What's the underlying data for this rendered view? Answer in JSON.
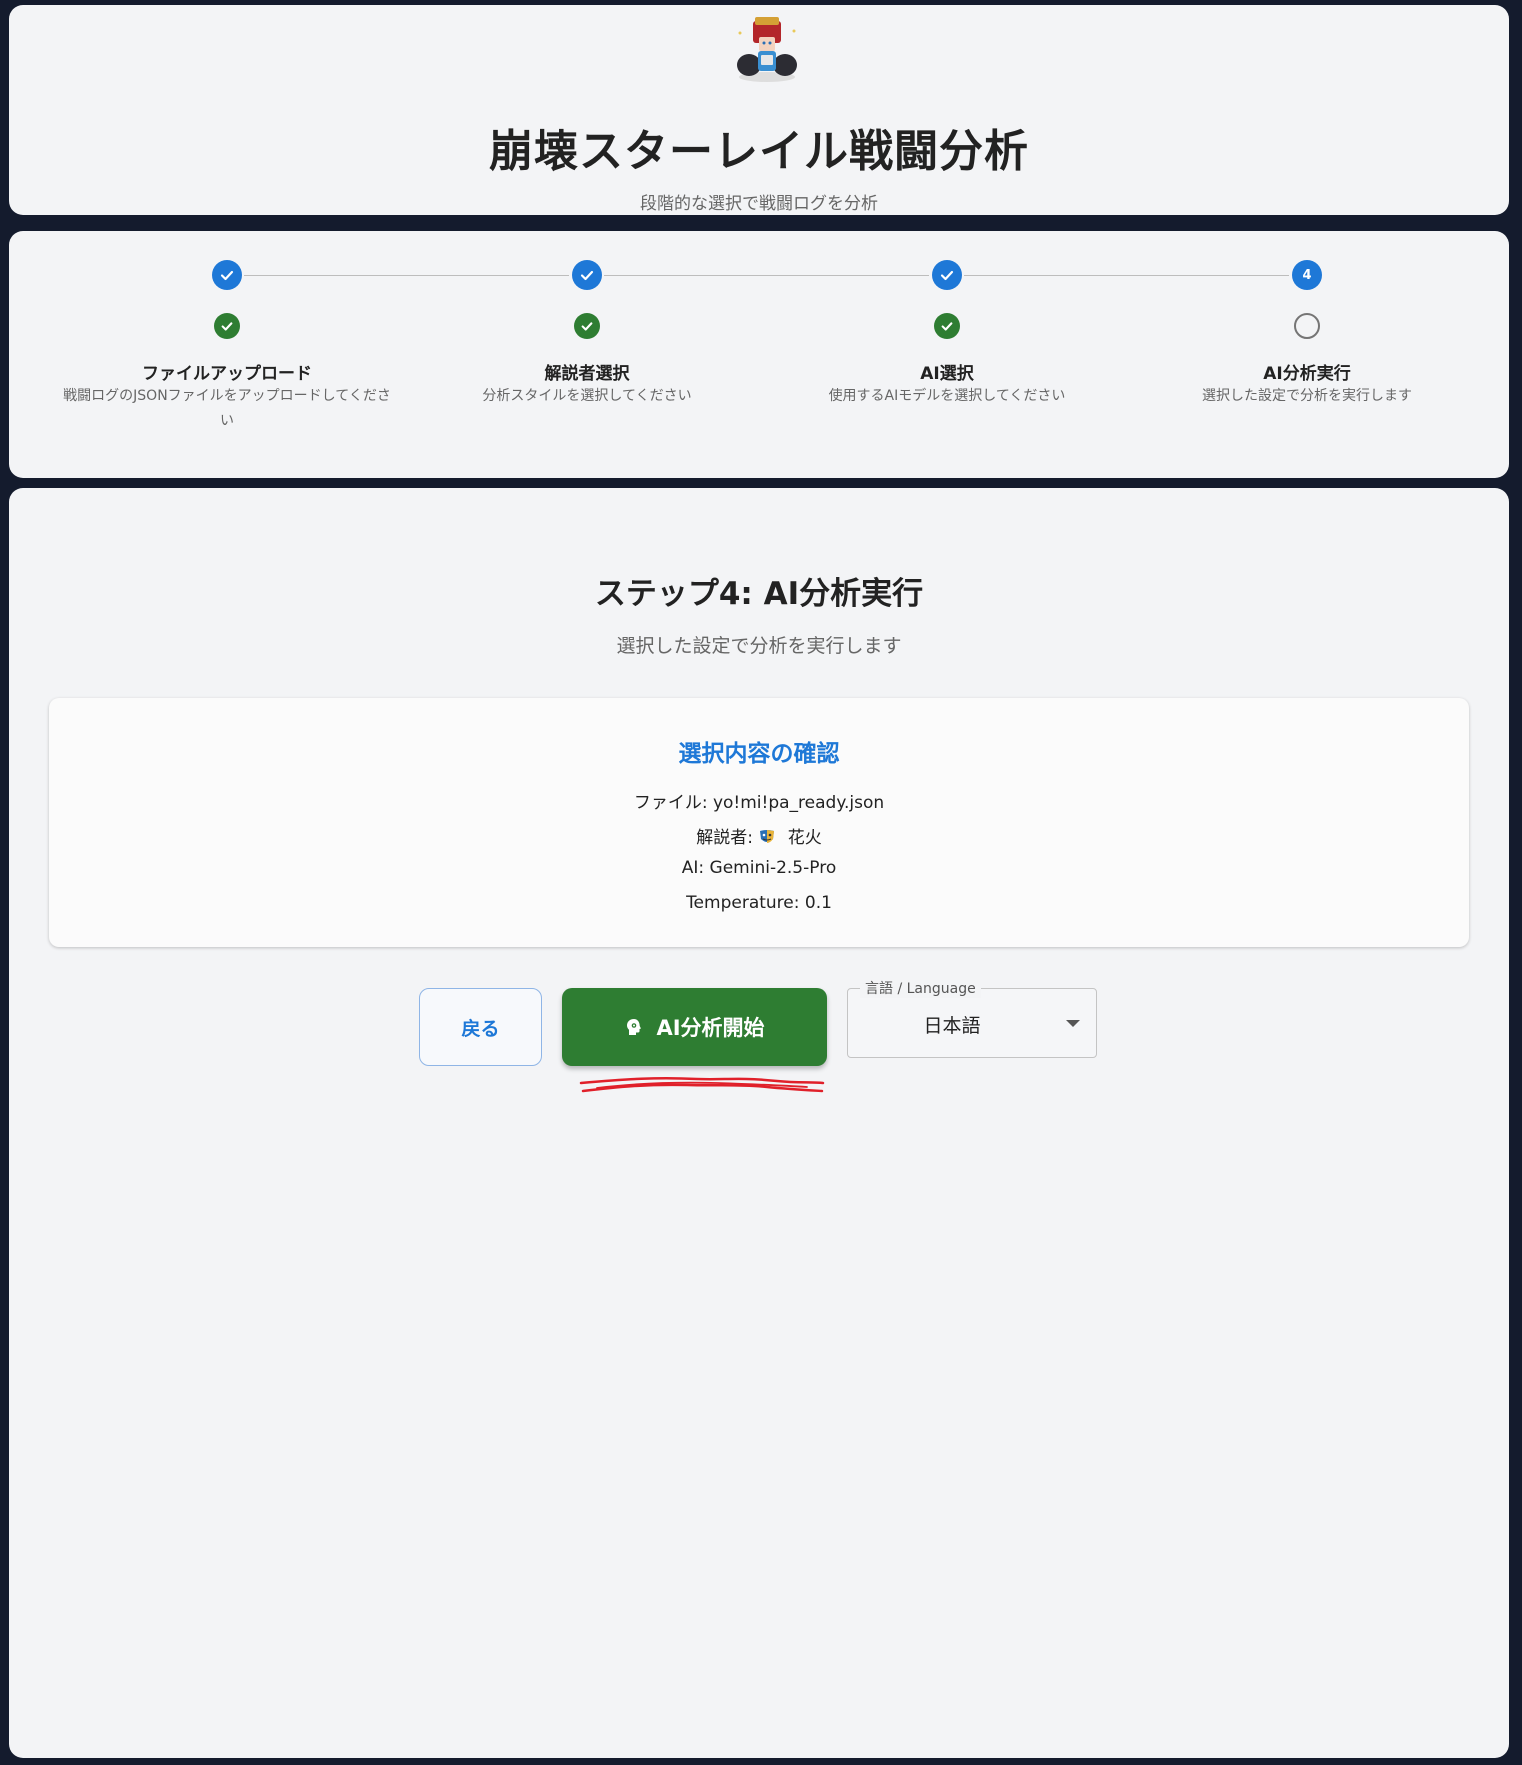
{
  "header": {
    "title": "崩壊スターレイル戦闘分析",
    "subtitle": "段階的な選択で戦闘ログを分析",
    "logo_icon": "character-mascot-icon"
  },
  "stepper": {
    "steps": [
      {
        "number": "1",
        "status": "completed",
        "title": "ファイルアップロード",
        "description": "戦闘ログのJSONファイルをアップロードしてください"
      },
      {
        "number": "2",
        "status": "completed",
        "title": "解説者選択",
        "description": "分析スタイルを選択してください"
      },
      {
        "number": "3",
        "status": "completed",
        "title": "AI選択",
        "description": "使用するAIモデルを選択してください"
      },
      {
        "number": "4",
        "status": "active",
        "title": "AI分析実行",
        "description": "選択した設定で分析を実行します"
      }
    ]
  },
  "main": {
    "title": "ステップ4: AI分析実行",
    "subtitle": "選択した設定で分析を実行します",
    "confirmation": {
      "title": "選択内容の確認",
      "file": "ファイル: yo!mi!pa_ready.json",
      "commentator_label": "解説者:",
      "commentator_name": "花火",
      "commentator_icon": "mask-emoji-icon",
      "ai": "AI: Gemini-2.5-Pro",
      "temperature": "Temperature: 0.1"
    },
    "back_button": "戻る",
    "start_button": "AI分析開始",
    "start_icon": "brain-head-icon",
    "language": {
      "legend": "言語 / Language",
      "value": "日本語"
    }
  },
  "colors": {
    "primary": "#1e78d7",
    "success": "#2e7d32",
    "annotation": "#e0202a",
    "background": "#141b2d"
  }
}
